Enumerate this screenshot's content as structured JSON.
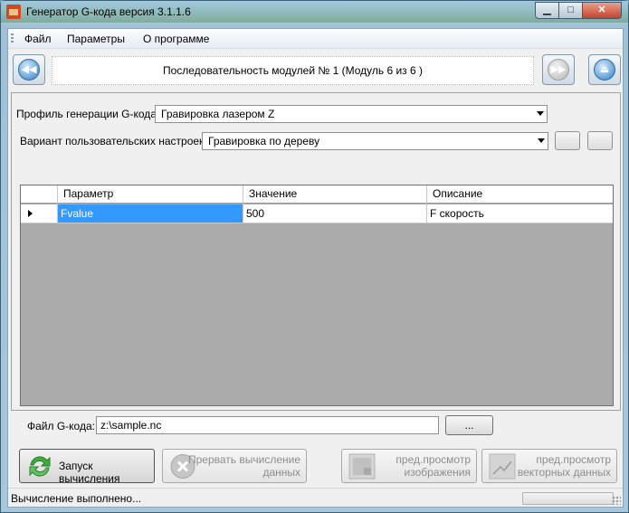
{
  "window": {
    "title": "Генератор G-кода версия 3.1.1.6",
    "minimize": "▁",
    "maximize": "□",
    "close": "✕"
  },
  "menu": {
    "items": [
      "Файл",
      "Параметры",
      "О программе"
    ]
  },
  "navigation": {
    "sequence_text": "Последовательность модулей № 1 (Модуль 6 из 6 )"
  },
  "settings": {
    "profile_label": "Профиль генерации G-кода:",
    "profile_value": "Гравировка лазером Z",
    "variant_label": "Вариант пользовательских настроек:",
    "variant_value": "Гравировка по дереву"
  },
  "grid": {
    "columns": [
      "Параметр",
      "Значение",
      "Описание"
    ],
    "rows": [
      {
        "param": "Fvalue",
        "value": "500",
        "description": "F скорость"
      }
    ]
  },
  "file": {
    "label": "Файл G-кода:",
    "value": "z:\\sample.nc",
    "browse": "..."
  },
  "actions": {
    "run": "Запуск вычисления",
    "abort_line1": "Прервать вычисление",
    "abort_line2": "данных",
    "preview_image_line1": "пред.просмотр",
    "preview_image_line2": "изображения",
    "preview_vector_line1": "пред.просмотр",
    "preview_vector_line2": "векторных данных"
  },
  "status": {
    "text": "Вычисление выполнено..."
  }
}
